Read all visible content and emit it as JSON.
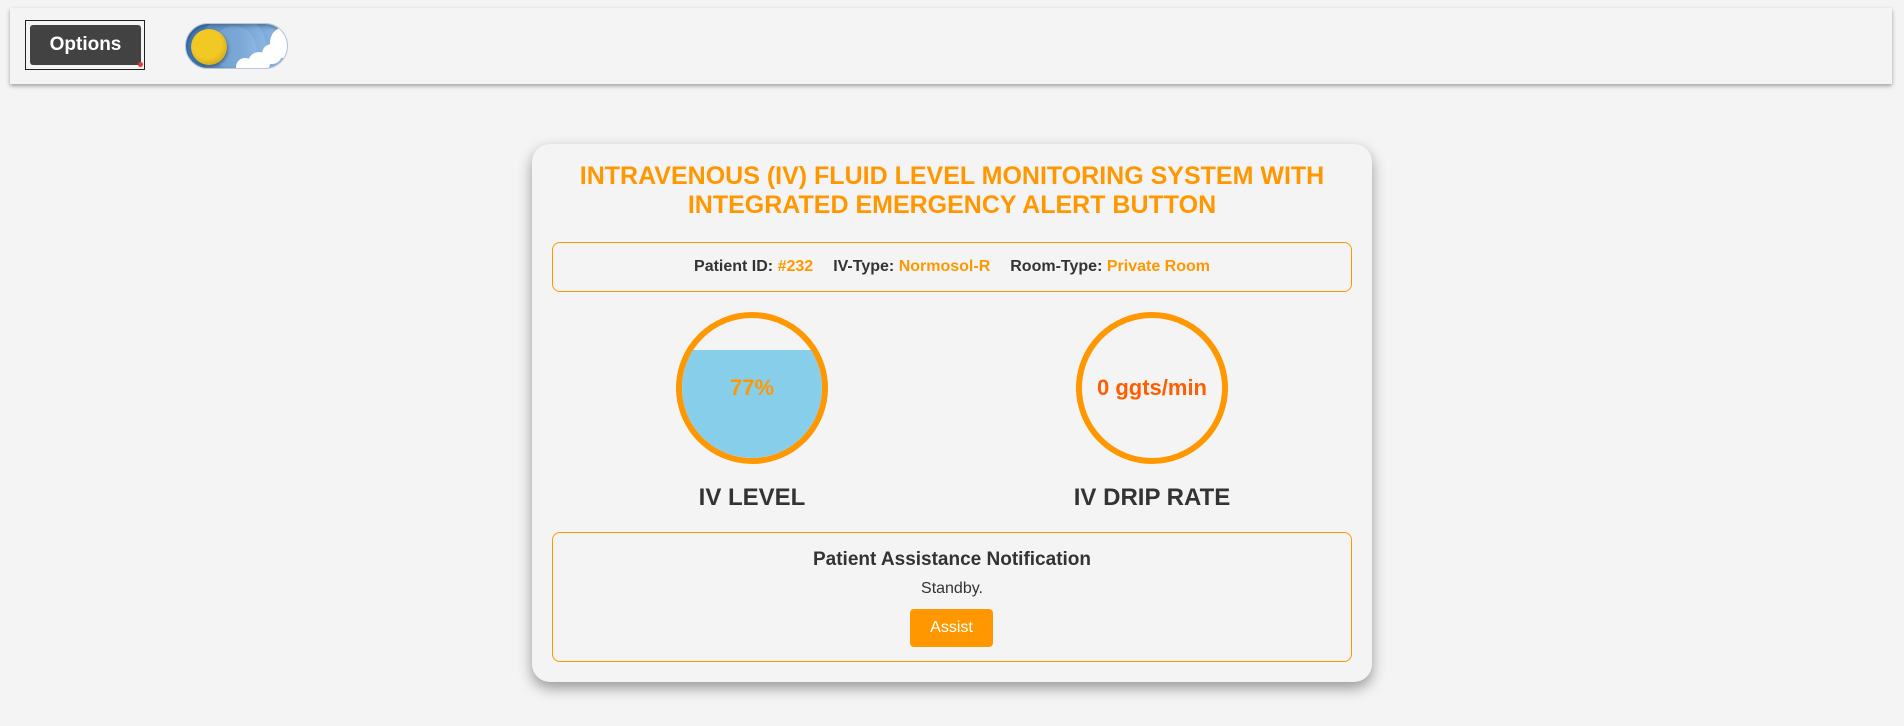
{
  "header": {
    "options_label": "Options",
    "theme_toggle": {
      "state": "day",
      "icon": "sun-icon"
    }
  },
  "card": {
    "title": "INTRAVENOUS (IV) FLUID LEVEL MONITORING SYSTEM WITH INTEGRATED EMERGENCY ALERT BUTTON",
    "patient": {
      "id_label": "Patient ID:",
      "id_value": "#232",
      "iv_type_label": "IV-Type:",
      "iv_type_value": "Normosol-R",
      "room_type_label": "Room-Type:",
      "room_type_value": "Private Room"
    },
    "iv_level": {
      "value_text": "77%",
      "fill_fraction": 0.77,
      "label": "IV LEVEL"
    },
    "drip_rate": {
      "value_text": "0 ggts/min",
      "label": "IV DRIP RATE"
    },
    "assistance": {
      "title": "Patient Assistance Notification",
      "status": "Standby.",
      "button_label": "Assist"
    }
  },
  "colors": {
    "accent": "#ff9800",
    "drip_text": "#ff5e00",
    "fluid": "#87ceeb",
    "button_dark": "#424242"
  }
}
